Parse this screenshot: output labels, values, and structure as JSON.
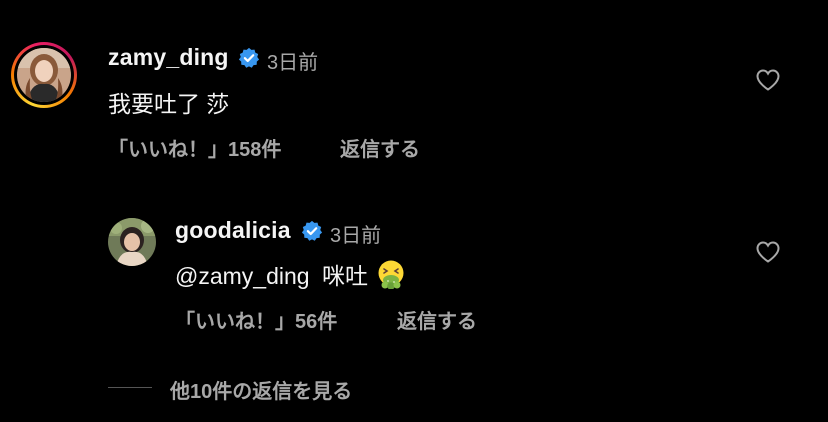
{
  "comments": [
    {
      "username": "zamy_ding",
      "verified": true,
      "time": "3日前",
      "text": "我要吐了 莎",
      "likes": "「いいね！」158件",
      "reply": "返信する"
    }
  ],
  "replies": [
    {
      "username": "goodalicia",
      "verified": true,
      "time": "3日前",
      "mention": "@zamy_ding",
      "text": "咪吐",
      "emoji": "vomiting-face",
      "likes": "「いいね！」56件",
      "reply": "返信する"
    }
  ],
  "view_more_replies": "他10件の返信を見る",
  "colors": {
    "background": "#000000",
    "primary_text": "#f5f5f5",
    "secondary_text": "#a8a8a8",
    "verified_badge": "#3897f0"
  }
}
